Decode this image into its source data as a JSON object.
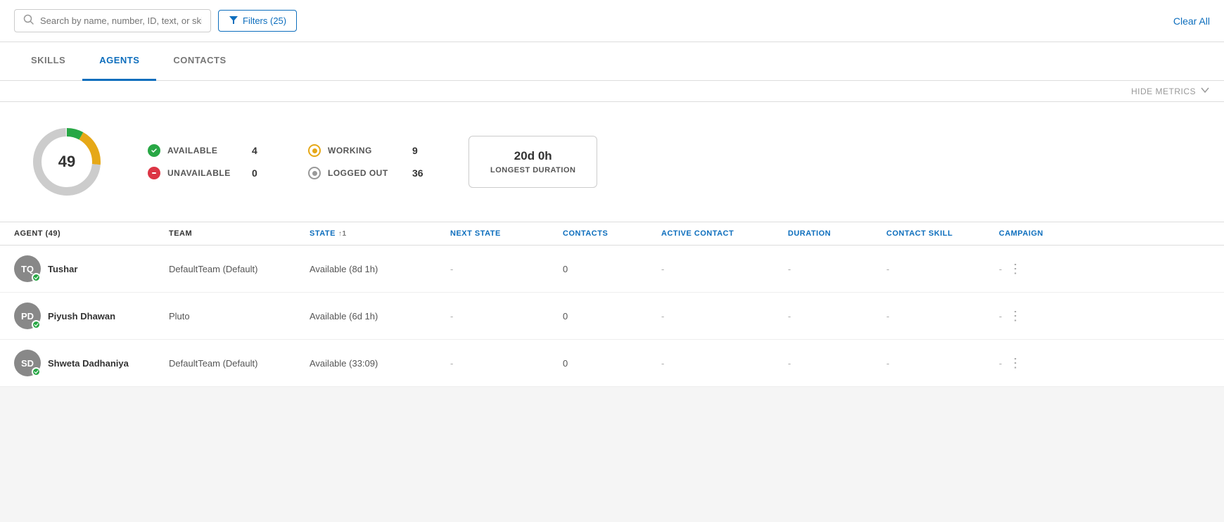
{
  "topbar": {
    "search_placeholder": "Search by name, number, ID, text, or skill",
    "filter_label": "Filters (25)",
    "clear_all_label": "Clear All"
  },
  "tabs": [
    {
      "id": "skills",
      "label": "SKILLS",
      "active": false
    },
    {
      "id": "agents",
      "label": "AGENTS",
      "active": true
    },
    {
      "id": "contacts",
      "label": "CONTACTS",
      "active": false
    }
  ],
  "metrics_toggle": {
    "label": "HIDE METRICS"
  },
  "metrics": {
    "donut": {
      "total": 49,
      "segments": [
        {
          "label": "available",
          "value": 4,
          "color": "#28a745",
          "pct": 8.16
        },
        {
          "label": "working",
          "value": 9,
          "color": "#e6a817",
          "pct": 18.37
        },
        {
          "label": "loggedout",
          "value": 36,
          "color": "#ccc",
          "pct": 73.47
        }
      ]
    },
    "statuses_left": [
      {
        "type": "available",
        "label": "AVAILABLE",
        "count": 4
      },
      {
        "type": "unavailable",
        "label": "UNAVAILABLE",
        "count": 0
      }
    ],
    "statuses_right": [
      {
        "type": "working",
        "label": "WORKING",
        "count": 9
      },
      {
        "type": "loggedout",
        "label": "LOGGED OUT",
        "count": 36
      }
    ],
    "duration": {
      "value": "20d 0h",
      "label": "LONGEST DURATION"
    }
  },
  "table": {
    "columns": [
      {
        "id": "agent",
        "label": "AGENT (49)",
        "color": "dark"
      },
      {
        "id": "team",
        "label": "TEAM",
        "color": "dark"
      },
      {
        "id": "state",
        "label": "STATE",
        "color": "blue",
        "sort": "↑1"
      },
      {
        "id": "next_state",
        "label": "NEXT STATE",
        "color": "blue"
      },
      {
        "id": "contacts",
        "label": "CONTACTS",
        "color": "blue"
      },
      {
        "id": "active_contact",
        "label": "ACTIVE CONTACT",
        "color": "blue"
      },
      {
        "id": "duration",
        "label": "DURATION",
        "color": "blue"
      },
      {
        "id": "contact_skill",
        "label": "CONTACT SKILL",
        "color": "blue"
      },
      {
        "id": "campaign",
        "label": "CAMPAIGN",
        "color": "blue"
      }
    ],
    "rows": [
      {
        "initials": "TQ",
        "name": "Tushar",
        "team": "DefaultTeam (Default)",
        "state": "Available (8d 1h)",
        "next_state": "-",
        "contacts": "0",
        "active_contact": "-",
        "duration": "-",
        "contact_skill": "-",
        "campaign": "-",
        "status": "available"
      },
      {
        "initials": "PD",
        "name": "Piyush Dhawan",
        "team": "Pluto",
        "state": "Available (6d 1h)",
        "next_state": "-",
        "contacts": "0",
        "active_contact": "-",
        "duration": "-",
        "contact_skill": "-",
        "campaign": "-",
        "status": "available"
      },
      {
        "initials": "SD",
        "name": "Shweta Dadhaniya",
        "team": "DefaultTeam (Default)",
        "state": "Available (33:09)",
        "next_state": "-",
        "contacts": "0",
        "active_contact": "-",
        "duration": "-",
        "contact_skill": "-",
        "campaign": "-",
        "status": "available"
      }
    ]
  }
}
